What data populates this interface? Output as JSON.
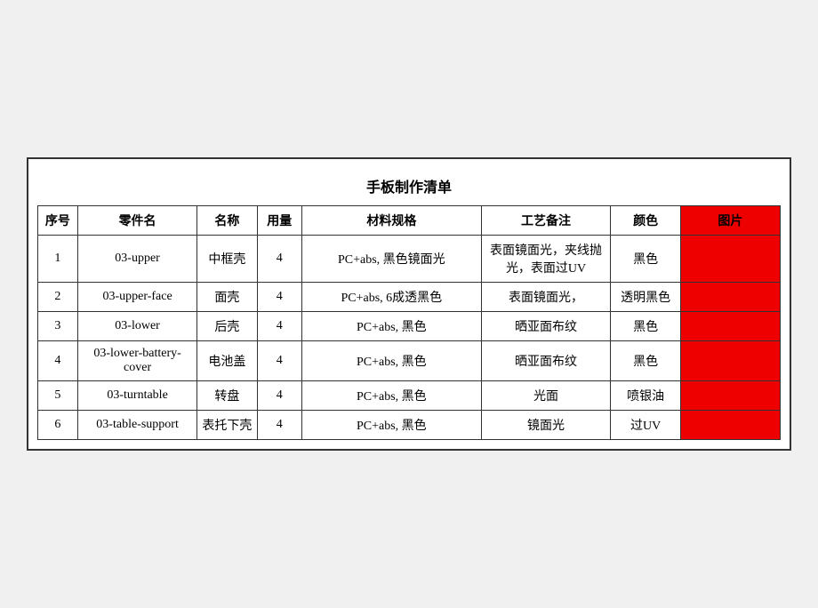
{
  "title": "手板制作清单",
  "headers": {
    "seq": "序号",
    "part": "零件名",
    "name": "名称",
    "qty": "用量",
    "material": "材料规格",
    "process": "工艺备注",
    "color": "颜色",
    "image": "图片"
  },
  "rows": [
    {
      "seq": "1",
      "part": "03-upper",
      "name": "中框壳",
      "qty": "4",
      "material": "PC+abs, 黑色镜面光",
      "process": "表面镜面光，夹线抛光，表面过UV",
      "color": "黑色"
    },
    {
      "seq": "2",
      "part": "03-upper-face",
      "name": "面壳",
      "qty": "4",
      "material": "PC+abs, 6成透黑色",
      "process": "表面镜面光，",
      "color": "透明黑色"
    },
    {
      "seq": "3",
      "part": "03-lower",
      "name": "后壳",
      "qty": "4",
      "material": "PC+abs, 黑色",
      "process": "晒亚面布纹",
      "color": "黑色"
    },
    {
      "seq": "4",
      "part": "03-lower-battery-cover",
      "name": "电池盖",
      "qty": "4",
      "material": "PC+abs, 黑色",
      "process": "晒亚面布纹",
      "color": "黑色"
    },
    {
      "seq": "5",
      "part": "03-turntable",
      "name": "转盘",
      "qty": "4",
      "material": "PC+abs, 黑色",
      "process": "光面",
      "color": "喷银油"
    },
    {
      "seq": "6",
      "part": "03-table-support",
      "name": "表托下壳",
      "qty": "4",
      "material": "PC+abs, 黑色",
      "process": "镜面光",
      "color": "过UV"
    }
  ]
}
